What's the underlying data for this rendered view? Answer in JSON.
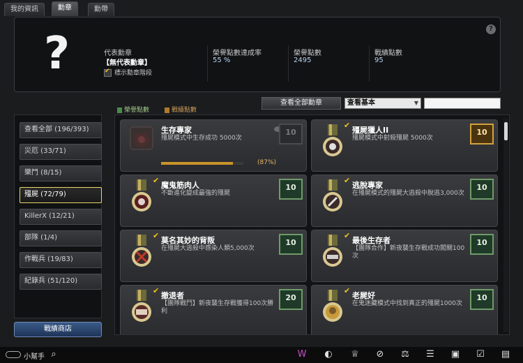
{
  "tabs": [
    "我的資訊",
    "勳章",
    "勳帶"
  ],
  "header": {
    "rep_label": "代表勳章",
    "rep_value": "【無代表勳章】",
    "show_level_label": "標示勳章階段",
    "rate_label": "榮譽點數達成率",
    "rate_value": "55 %",
    "honor_label": "榮譽點數",
    "honor_value": "2495",
    "battle_label": "戰績點數",
    "battle_value": "95",
    "help": "?"
  },
  "legend": {
    "honor": "榮譽點數",
    "battle": "戰績點數"
  },
  "toolbar": {
    "view_all": "查看全部勳章",
    "view_select": "查看基本"
  },
  "sidebar": {
    "items": [
      "查看全部 (196/393)",
      "災厄 (33/71)",
      "樂鬥 (8/15)",
      "殭屍 (72/79)",
      "KillerX (12/21)",
      "部隊 (1/4)",
      "作戰兵 (19/83)",
      "紀錄兵 (51/120)"
    ],
    "selected_index": 3,
    "shop": "戰績商店"
  },
  "medals": [
    {
      "title": "生存專家",
      "desc": "殭屍模式中生存成功 5000次",
      "points": "10",
      "progress": 0.87,
      "progress_label": "(87%)",
      "earned": false
    },
    {
      "title": "殭屍獵人II",
      "desc": "殭屍模式中射殺殭屍 5000次",
      "points": "10",
      "earned": true
    },
    {
      "title": "魔鬼筋肉人",
      "desc": "不斷進化變成最強的殭屍",
      "points": "10",
      "earned": true
    },
    {
      "title": "逃脫專家",
      "desc": "在殭屍模式的殭屍大逃殺中脫逃3,000次",
      "points": "10",
      "earned": true
    },
    {
      "title": "莫名其妙的背叛",
      "desc": "在殭屍大逃殺中感染人類5,000次",
      "points": "10",
      "earned": true
    },
    {
      "title": "最後生存者",
      "desc": "【團隊合作】新夜襲生存戰成功闖關100次",
      "points": "10",
      "earned": true
    },
    {
      "title": "撤退者",
      "desc": "【團隊戰鬥】新夜襲生存戰獲得100次勝利",
      "points": "20",
      "earned": true
    },
    {
      "title": "老屍好",
      "desc": "在鬼迷藏模式中找到真正的殭屍1000次",
      "points": "10",
      "earned": true
    }
  ],
  "bottom": {
    "helper": "小幫手"
  },
  "colors": {
    "accent_gold": "#f2c21a",
    "points_green": "#6f9b6a",
    "points_gold": "#d3a240",
    "shop_blue": "#2b4a78"
  }
}
